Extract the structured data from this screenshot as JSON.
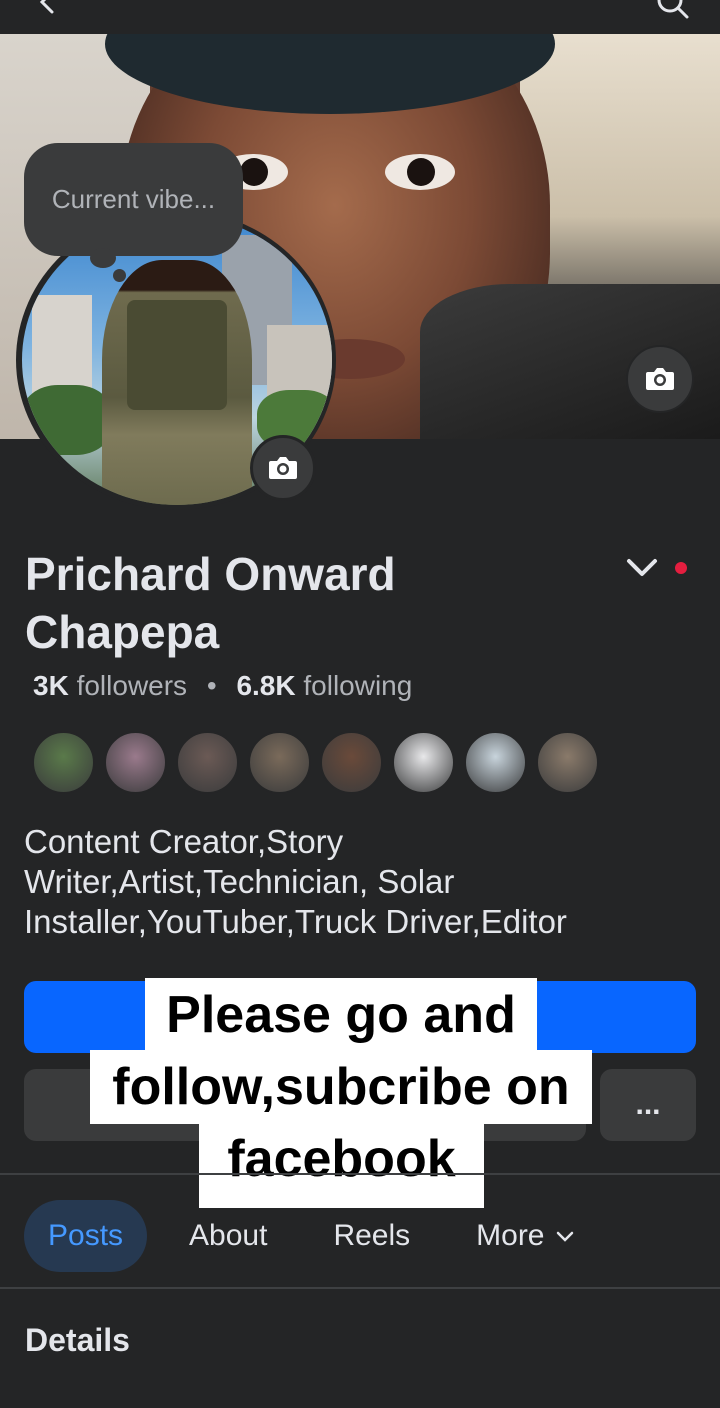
{
  "header": {
    "back_icon": "back-arrow-icon",
    "search_icon": "search-icon"
  },
  "profile": {
    "status_bubble": "Current vibe...",
    "name": "Prichard Onward Chapepa",
    "followers_count": "3K",
    "followers_label": "followers",
    "separator": "•",
    "following_count": "6.8K",
    "following_label": "following",
    "bio": "Content Creator,Story Writer,Artist,Technician, Solar Installer,YouTuber,Truck Driver,Editor",
    "friends": [
      {
        "color": "#5a7a4a"
      },
      {
        "color": "#9a7a8c"
      },
      {
        "color": "#6b5a55"
      },
      {
        "color": "#7a6a5a"
      },
      {
        "color": "#6a4a3a"
      },
      {
        "color": "#e8e8ea"
      },
      {
        "color": "#c8d4dc"
      },
      {
        "color": "#8a7a6a"
      }
    ]
  },
  "actions": {
    "more_label": "..."
  },
  "overlay": {
    "line1": "Please go and",
    "line2": "follow,subcribe on",
    "line3": "facebook"
  },
  "tabs": [
    {
      "label": "Posts",
      "active": true
    },
    {
      "label": "About"
    },
    {
      "label": "Reels"
    },
    {
      "label": "More"
    }
  ],
  "sections": {
    "details_title": "Details"
  },
  "colors": {
    "background": "#242526",
    "primary": "#0866ff",
    "active_tab_bg": "#263951",
    "active_tab_text": "#4599ff",
    "notification_dot": "#e41e3f"
  }
}
